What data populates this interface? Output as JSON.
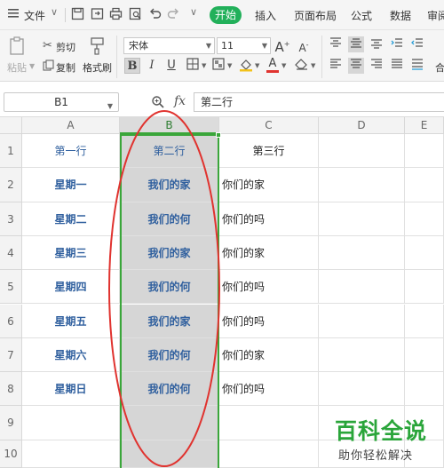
{
  "menu": {
    "file_label": "文件",
    "tabs": [
      "插入",
      "页面布局",
      "公式",
      "数据",
      "审阅"
    ],
    "active_tab": "开始"
  },
  "ribbon": {
    "paste_label": "粘贴",
    "cut_label": "剪切",
    "copy_label": "复制",
    "format_painter_label": "格式刷",
    "font_name": "宋体",
    "font_size": "11",
    "merge_label_partial": "合"
  },
  "formula_bar": {
    "cell_ref": "B1",
    "fx_label": "fx",
    "content": "第二行"
  },
  "grid": {
    "columns": [
      "A",
      "B",
      "C",
      "D",
      "E"
    ],
    "rows": [
      "1",
      "2",
      "3",
      "4",
      "5",
      "6",
      "7",
      "8",
      "9",
      "10"
    ],
    "col_a": [
      "第一行",
      "星期一",
      "星期二",
      "星期三",
      "星期四",
      "星期五",
      "星期六",
      "星期日",
      "",
      ""
    ],
    "col_b": [
      "第二行",
      "我们的家",
      "我们的何",
      "我们的家",
      "我们的何",
      "我们的家",
      "我们的何",
      "我们的何",
      "",
      ""
    ],
    "col_c": [
      "第三行",
      "你们的家",
      "你们的吗",
      "你们的家",
      "你们的吗",
      "你们的吗",
      "你们的家",
      "你们的吗",
      "",
      ""
    ]
  },
  "colors": {
    "accent_green": "#22b05a",
    "selection_green": "#3aa63a",
    "header_text_blue": "#2f5f9e",
    "annotation_red": "#e0332f"
  },
  "watermark": {
    "line1": "百科全说",
    "line2": "助你轻松解决"
  }
}
